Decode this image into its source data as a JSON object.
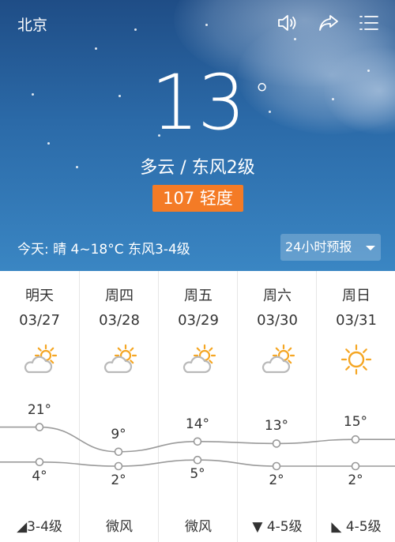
{
  "header": {
    "city": "北京",
    "temperature": "13",
    "degree_symbol": "°",
    "condition": "多云 / 东风2级",
    "aqi_label": "107 轻度",
    "today_summary": "今天:  晴  4~18°C  东风3-4级",
    "hourly_button": "24小时预报",
    "icons": [
      "speaker-icon",
      "share-icon",
      "menu-icon"
    ],
    "aqi_color": "#f47b26"
  },
  "forecast": [
    {
      "day": "明天",
      "date": "03/27",
      "icon": "partly-cloudy",
      "high": "21°",
      "low": "4°",
      "wind_dir": "southwest",
      "wind": "3-4级"
    },
    {
      "day": "周四",
      "date": "03/28",
      "icon": "partly-cloudy",
      "high": "9°",
      "low": "2°",
      "wind_dir": "",
      "wind": "微风"
    },
    {
      "day": "周五",
      "date": "03/29",
      "icon": "partly-cloudy",
      "high": "14°",
      "low": "5°",
      "wind_dir": "",
      "wind": "微风"
    },
    {
      "day": "周六",
      "date": "03/30",
      "icon": "partly-cloudy",
      "high": "13°",
      "low": "2°",
      "wind_dir": "south",
      "wind": "4-5级"
    },
    {
      "day": "周日",
      "date": "03/31",
      "icon": "sunny",
      "high": "15°",
      "low": "2°",
      "wind_dir": "southeast",
      "wind": "4-5级"
    }
  ],
  "chart_data": {
    "type": "line",
    "categories": [
      "明天",
      "周四",
      "周五",
      "周六",
      "周日"
    ],
    "series": [
      {
        "name": "high",
        "values": [
          21,
          9,
          14,
          13,
          15
        ]
      },
      {
        "name": "low",
        "values": [
          4,
          2,
          5,
          2,
          2
        ]
      }
    ],
    "colors": {
      "line": "#9a9a9a",
      "sun": "#f5a623",
      "cloud": "#b9b9b9"
    }
  }
}
